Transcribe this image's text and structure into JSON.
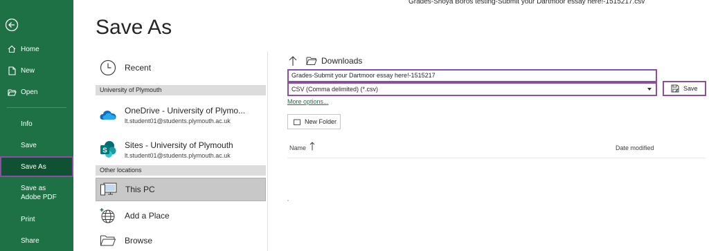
{
  "window": {
    "title": "Grades-Shoya Boros testing-Submit your Dartmoor essay here!-1515217.csv"
  },
  "nav": {
    "back_icon": "back-arrow-icon",
    "items": [
      {
        "label": "Home",
        "icon": "home-icon"
      },
      {
        "label": "New",
        "icon": "new-document-icon"
      },
      {
        "label": "Open",
        "icon": "open-folder-icon"
      },
      {
        "label": "Info"
      },
      {
        "label": "Save"
      },
      {
        "label": "Save As",
        "selected": true
      },
      {
        "label": "Save as Adobe PDF"
      },
      {
        "label": "Print"
      },
      {
        "label": "Share"
      }
    ]
  },
  "page": {
    "title": "Save As"
  },
  "locations": {
    "recent": {
      "label": "Recent",
      "icon": "clock-icon"
    },
    "section_university": "University of Plymouth",
    "onedrive": {
      "name": "OneDrive - University of Plymo...",
      "email": "lt.student01@students.plymouth.ac.uk",
      "icon": "onedrive-cloud-icon"
    },
    "sites": {
      "name": "Sites - University of Plymouth",
      "email": "lt.student01@students.plymouth.ac.uk",
      "icon": "sharepoint-icon"
    },
    "section_other": "Other locations",
    "this_pc": {
      "label": "This PC",
      "icon": "computer-icon",
      "selected": true
    },
    "add_place": {
      "label": "Add a Place",
      "icon": "globe-add-icon"
    },
    "browse": {
      "label": "Browse",
      "icon": "folder-icon"
    }
  },
  "save_panel": {
    "breadcrumb": "Downloads",
    "filename": "Grades-Submit your Dartmoor essay here!-1515217",
    "filetype": "CSV (Comma delimited) (*.csv)",
    "save_label": "Save",
    "more_options": "More options...",
    "new_folder": "New Folder",
    "col_name": "Name",
    "col_date": "Date modified"
  },
  "colors": {
    "nav_bg": "#1e7145",
    "nav_selected": "#0f5132",
    "highlight": "#8a4f9e",
    "link": "#1e7145"
  }
}
